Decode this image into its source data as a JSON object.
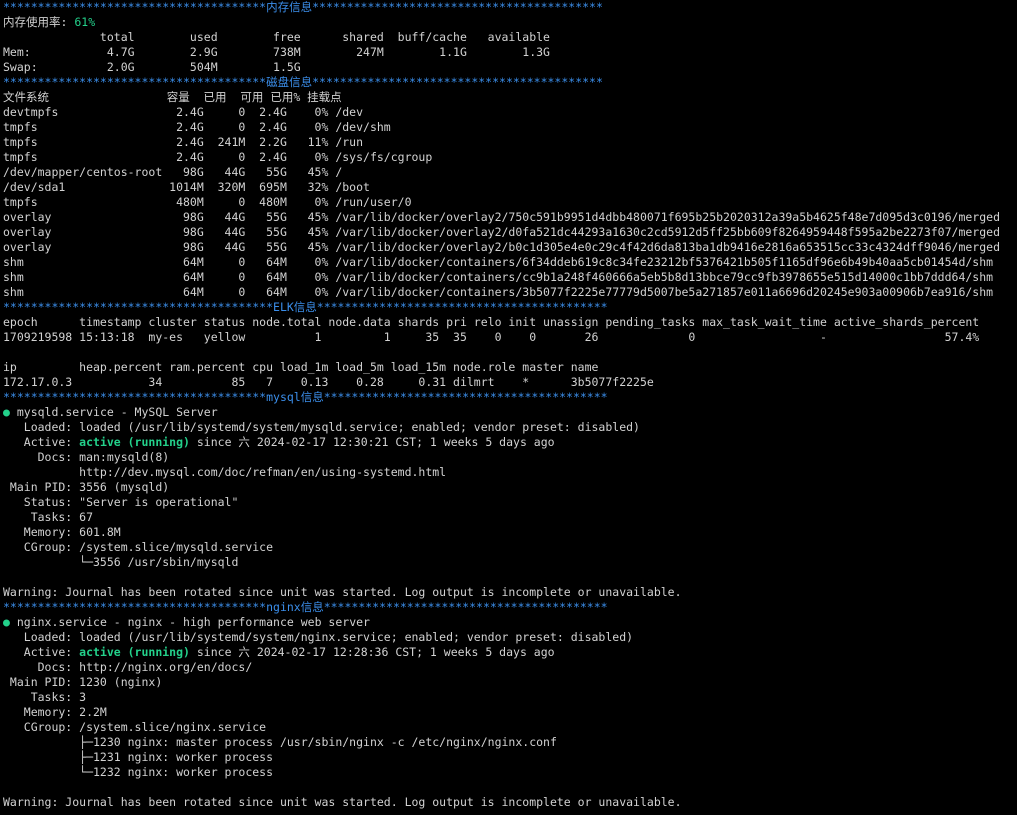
{
  "terminal": {
    "colors": {
      "background": "#000000",
      "text": "#d2d2d2",
      "banner": "#3b8eea",
      "green": "#23d18b"
    },
    "lines": [
      {
        "t": "banner",
        "text": "**************************************内存信息******************************************"
      },
      {
        "t": "usage",
        "label": "内存使用率: ",
        "value": "61%"
      },
      {
        "t": "text",
        "text": "              total        used        free      shared  buff/cache   available"
      },
      {
        "t": "text",
        "text": "Mem:           4.7G        2.9G        738M        247M        1.1G        1.3G"
      },
      {
        "t": "text",
        "text": "Swap:          2.0G        504M        1.5G"
      },
      {
        "t": "banner",
        "text": "**************************************磁盘信息******************************************"
      },
      {
        "t": "text",
        "text": "文件系统                 容量  已用  可用 已用% 挂载点"
      },
      {
        "t": "text",
        "text": "devtmpfs                 2.4G     0  2.4G    0% /dev"
      },
      {
        "t": "text",
        "text": "tmpfs                    2.4G     0  2.4G    0% /dev/shm"
      },
      {
        "t": "text",
        "text": "tmpfs                    2.4G  241M  2.2G   11% /run"
      },
      {
        "t": "text",
        "text": "tmpfs                    2.4G     0  2.4G    0% /sys/fs/cgroup"
      },
      {
        "t": "text",
        "text": "/dev/mapper/centos-root   98G   44G   55G   45% /"
      },
      {
        "t": "text",
        "text": "/dev/sda1               1014M  320M  695M   32% /boot"
      },
      {
        "t": "text",
        "text": "tmpfs                    480M     0  480M    0% /run/user/0"
      },
      {
        "t": "text",
        "text": "overlay                   98G   44G   55G   45% /var/lib/docker/overlay2/750c591b9951d4dbb480071f695b25b2020312a39a5b4625f48e7d095d3c0196/merged"
      },
      {
        "t": "text",
        "text": "overlay                   98G   44G   55G   45% /var/lib/docker/overlay2/d0fa521dc44293a1630c2cd5912d5ff25bb609f8264959448f595a2be2273f07/merged"
      },
      {
        "t": "text",
        "text": "overlay                   98G   44G   55G   45% /var/lib/docker/overlay2/b0c1d305e4e0c29c4f42d6da813ba1db9416e2816a653515cc33c4324dff9046/merged"
      },
      {
        "t": "text",
        "text": "shm                       64M     0   64M    0% /var/lib/docker/containers/6f34ddeb619c8c34fe23212bf5376421b505f1165df96e6b49b40aa5cb01454d/shm"
      },
      {
        "t": "text",
        "text": "shm                       64M     0   64M    0% /var/lib/docker/containers/cc9b1a248f460666a5eb5b8d13bbce79cc9fb3978655e515d14000c1bb7ddd64/shm"
      },
      {
        "t": "text",
        "text": "shm                       64M     0   64M    0% /var/lib/docker/containers/3b5077f2225e77779d5007be5a271857e011a6696d20245e903a00906b7ea916/shm"
      },
      {
        "t": "banner",
        "text": "***************************************ELK信息******************************************"
      },
      {
        "t": "text",
        "text": "epoch      timestamp cluster status node.total node.data shards pri relo init unassign pending_tasks max_task_wait_time active_shards_percent"
      },
      {
        "t": "text",
        "text": "1709219598 15:13:18  my-es   yellow          1         1     35  35    0    0       26             0                  -                 57.4%"
      },
      {
        "t": "blank",
        "text": ""
      },
      {
        "t": "text",
        "text": "ip         heap.percent ram.percent cpu load_1m load_5m load_15m node.role master name"
      },
      {
        "t": "text",
        "text": "172.17.0.3           34          85   7    0.13    0.28     0.31 dilmrt    *      3b5077f2225e"
      },
      {
        "t": "banner",
        "text": "**************************************mysql信息*****************************************"
      },
      {
        "t": "service",
        "dot": "●",
        "text": " mysqld.service - MySQL Server"
      },
      {
        "t": "text",
        "text": "   Loaded: loaded (/usr/lib/systemd/system/mysqld.service; enabled; vendor preset: disabled)"
      },
      {
        "t": "activeline",
        "pre": "   Active: ",
        "status": "active (running)",
        "post": " since 六 2024-02-17 12:30:21 CST; 1 weeks 5 days ago"
      },
      {
        "t": "text",
        "text": "     Docs: man:mysqld(8)"
      },
      {
        "t": "text",
        "text": "           http://dev.mysql.com/doc/refman/en/using-systemd.html"
      },
      {
        "t": "text",
        "text": " Main PID: 3556 (mysqld)"
      },
      {
        "t": "text",
        "text": "   Status: \"Server is operational\""
      },
      {
        "t": "text",
        "text": "    Tasks: 67"
      },
      {
        "t": "text",
        "text": "   Memory: 601.8M"
      },
      {
        "t": "text",
        "text": "   CGroup: /system.slice/mysqld.service"
      },
      {
        "t": "text",
        "text": "           └─3556 /usr/sbin/mysqld"
      },
      {
        "t": "blank",
        "text": ""
      },
      {
        "t": "text",
        "text": "Warning: Journal has been rotated since unit was started. Log output is incomplete or unavailable."
      },
      {
        "t": "banner",
        "text": "**************************************nginx信息*****************************************"
      },
      {
        "t": "service",
        "dot": "●",
        "text": " nginx.service - nginx - high performance web server"
      },
      {
        "t": "text",
        "text": "   Loaded: loaded (/usr/lib/systemd/system/nginx.service; enabled; vendor preset: disabled)"
      },
      {
        "t": "activeline",
        "pre": "   Active: ",
        "status": "active (running)",
        "post": " since 六 2024-02-17 12:28:36 CST; 1 weeks 5 days ago"
      },
      {
        "t": "text",
        "text": "     Docs: http://nginx.org/en/docs/"
      },
      {
        "t": "text",
        "text": " Main PID: 1230 (nginx)"
      },
      {
        "t": "text",
        "text": "    Tasks: 3"
      },
      {
        "t": "text",
        "text": "   Memory: 2.2M"
      },
      {
        "t": "text",
        "text": "   CGroup: /system.slice/nginx.service"
      },
      {
        "t": "text",
        "text": "           ├─1230 nginx: master process /usr/sbin/nginx -c /etc/nginx/nginx.conf"
      },
      {
        "t": "text",
        "text": "           ├─1231 nginx: worker process"
      },
      {
        "t": "text",
        "text": "           └─1232 nginx: worker process"
      },
      {
        "t": "blank",
        "text": ""
      },
      {
        "t": "text",
        "text": "Warning: Journal has been rotated since unit was started. Log output is incomplete or unavailable."
      }
    ]
  }
}
